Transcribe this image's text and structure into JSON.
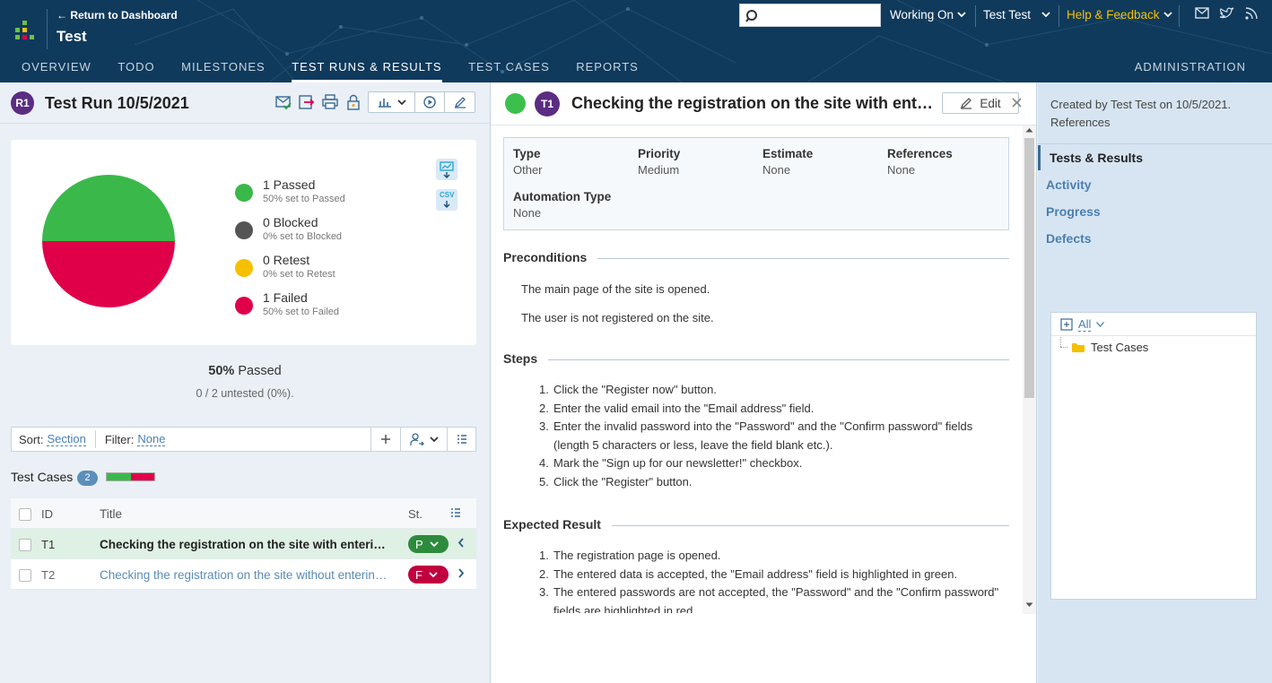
{
  "header": {
    "back_link": "← Return to Dashboard",
    "project": "Test",
    "search_placeholder": "",
    "working_on": "Working On",
    "user": "Test Test",
    "help": "Help & Feedback",
    "tabs": [
      "OVERVIEW",
      "TODO",
      "MILESTONES",
      "TEST RUNS & RESULTS",
      "TEST CASES",
      "REPORTS"
    ],
    "admin": "ADMINISTRATION"
  },
  "run": {
    "badge": "R1",
    "title": "Test Run 10/5/2021",
    "legend": [
      {
        "label": "1 Passed",
        "sub": "50% set to Passed",
        "color": "#3bb84a"
      },
      {
        "label": "0 Blocked",
        "sub": "0% set to Blocked",
        "color": "#555555"
      },
      {
        "label": "0 Retest",
        "sub": "0% set to Retest",
        "color": "#f5c000"
      },
      {
        "label": "1 Failed",
        "sub": "50% set to Failed",
        "color": "#e0004a"
      }
    ],
    "csv_label": "CSV",
    "passed_pct": "50%",
    "passed_word": "Passed",
    "untested": "0 / 2 untested (0%).",
    "sort_label": "Sort:",
    "sort_value": "Section",
    "filter_label": "Filter:",
    "filter_value": "None",
    "tc_heading": "Test Cases",
    "tc_count": "2",
    "table": {
      "col_id": "ID",
      "col_title": "Title",
      "col_status": "St.",
      "rows": [
        {
          "id": "T1",
          "title": "Checking the registration on the site with entering the invalid password",
          "status": "P",
          "color": "#2e8b3d"
        },
        {
          "id": "T2",
          "title": "Checking the registration on the site without entering data",
          "status": "F",
          "color": "#c0003f"
        }
      ]
    }
  },
  "chart_data": {
    "type": "pie",
    "categories": [
      "Passed",
      "Blocked",
      "Retest",
      "Failed"
    ],
    "values": [
      1,
      0,
      0,
      1
    ],
    "colors": [
      "#3bb84a",
      "#555555",
      "#f5c000",
      "#e0004a"
    ]
  },
  "test": {
    "badge": "T1",
    "title": "Checking the registration on the site with entering the invalid password",
    "edit": "Edit",
    "fields": [
      {
        "key": "Type",
        "value": "Other"
      },
      {
        "key": "Priority",
        "value": "Medium"
      },
      {
        "key": "Estimate",
        "value": "None"
      },
      {
        "key": "References",
        "value": "None"
      },
      {
        "key": "Automation Type",
        "value": "None"
      }
    ],
    "preconditions_title": "Preconditions",
    "preconditions": [
      "The main page of the site is opened.",
      "The user is not registered on the site."
    ],
    "steps_title": "Steps",
    "steps": [
      "Click the \"Register now\" button.",
      "Enter the valid email into the \"Email address\" field.",
      "Enter the invalid password into the \"Password\" and the \"Confirm password\" fields (length 5 characters or less, leave the field blank etc.).",
      "Mark the \"Sign up for our newsletter!\" checkbox.",
      "Click the \"Register\" button."
    ],
    "expected_title": "Expected Result",
    "expected": [
      "The registration page is opened.",
      "The entered data is accepted, the \"Email address\" field is highlighted in green.",
      "The entered passwords are not accepted, the \"Password\" and the \"Confirm password\" fields are highlighted in red."
    ]
  },
  "sidebar": {
    "created": "Created by Test Test on 10/5/2021.",
    "references": "References",
    "nav": [
      "Tests & Results",
      "Activity",
      "Progress",
      "Defects"
    ],
    "tree_all": "All",
    "tree_item": "Test Cases"
  },
  "colors": {
    "navy": "#0f3a5c",
    "accent": "#f5c000",
    "link": "#4a7fb0"
  }
}
